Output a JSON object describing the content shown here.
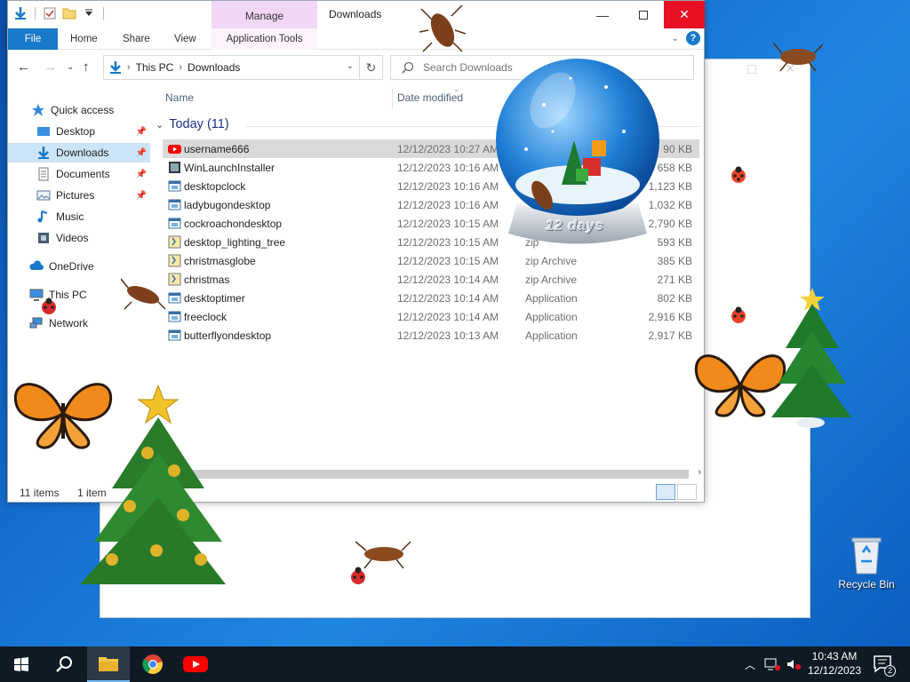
{
  "window": {
    "title": "Downloads",
    "contextual_tab": "Manage",
    "min_label": "—",
    "close_label": "✕"
  },
  "ribbon": {
    "tabs": [
      "File",
      "Home",
      "Share",
      "View"
    ],
    "contextual_sub": "Application Tools"
  },
  "address": {
    "crumbs": [
      "This PC",
      "Downloads"
    ],
    "search_placeholder": "Search Downloads"
  },
  "nav": {
    "items": [
      {
        "label": "Quick access",
        "icon": "star-icon"
      },
      {
        "label": "Desktop",
        "icon": "desktop-icon",
        "pinned": true
      },
      {
        "label": "Downloads",
        "icon": "download-arrow-icon",
        "pinned": true,
        "selected": true
      },
      {
        "label": "Documents",
        "icon": "documents-icon",
        "pinned": true
      },
      {
        "label": "Pictures",
        "icon": "pictures-icon",
        "pinned": true
      },
      {
        "label": "Music",
        "icon": "music-icon"
      },
      {
        "label": "Videos",
        "icon": "videos-icon"
      },
      {
        "label": "OneDrive",
        "icon": "cloud-icon"
      },
      {
        "label": "This PC",
        "icon": "computer-icon"
      },
      {
        "label": "Network",
        "icon": "network-icon"
      }
    ]
  },
  "columns": {
    "name": "Name",
    "date": "Date modified"
  },
  "group": {
    "label": "Today (11)"
  },
  "files": [
    {
      "name": "username666",
      "date": "12/12/2023 10:27 AM",
      "type": "",
      "size": "90 KB",
      "icon": "youtube-icon",
      "selected": true
    },
    {
      "name": "WinLaunchInstaller",
      "date": "12/12/2023 10:16 AM",
      "type": "",
      "size": "658 KB",
      "icon": "installer-icon"
    },
    {
      "name": "desktopclock",
      "date": "12/12/2023 10:16 AM",
      "type": "",
      "size": "1,123 KB",
      "icon": "app-icon"
    },
    {
      "name": "ladybugondesktop",
      "date": "12/12/2023 10:16 AM",
      "type": "",
      "size": "1,032 KB",
      "icon": "app-icon"
    },
    {
      "name": "cockroachondesktop",
      "date": "12/12/2023 10:15 AM",
      "type": "",
      "size": "2,790 KB",
      "icon": "app-icon"
    },
    {
      "name": "desktop_lighting_tree",
      "date": "12/12/2023 10:15 AM",
      "type": "zip",
      "size": "593 KB",
      "icon": "zip-icon"
    },
    {
      "name": "christmasglobe",
      "date": "12/12/2023 10:15 AM",
      "type": "zip Archive",
      "size": "385 KB",
      "icon": "zip-icon"
    },
    {
      "name": "christmas",
      "date": "12/12/2023 10:14 AM",
      "type": "zip Archive",
      "size": "271 KB",
      "icon": "zip-icon"
    },
    {
      "name": "desktoptimer",
      "date": "12/12/2023 10:14 AM",
      "type": "Application",
      "size": "802 KB",
      "icon": "app-icon"
    },
    {
      "name": "freeclock",
      "date": "12/12/2023 10:14 AM",
      "type": "Application",
      "size": "2,916 KB",
      "icon": "app-icon"
    },
    {
      "name": "butterflyondesktop",
      "date": "12/12/2023 10:13 AM",
      "type": "Application",
      "size": "2,917 KB",
      "icon": "app-icon"
    }
  ],
  "status": {
    "items": "11 items",
    "selected": "1 item"
  },
  "globe": {
    "label": "12 days"
  },
  "desktop": {
    "recycle_bin": "Recycle Bin"
  },
  "taskbar": {
    "apps": [
      "start-icon",
      "search-icon",
      "file-explorer-icon",
      "chrome-icon",
      "youtube-icon"
    ],
    "time": "10:43 AM",
    "date": "12/12/2023",
    "notifications": "2"
  },
  "colors": {
    "accent": "#1979ca",
    "close": "#e81123",
    "manage": "#f2d6f5",
    "taskbar": "#101a24"
  }
}
